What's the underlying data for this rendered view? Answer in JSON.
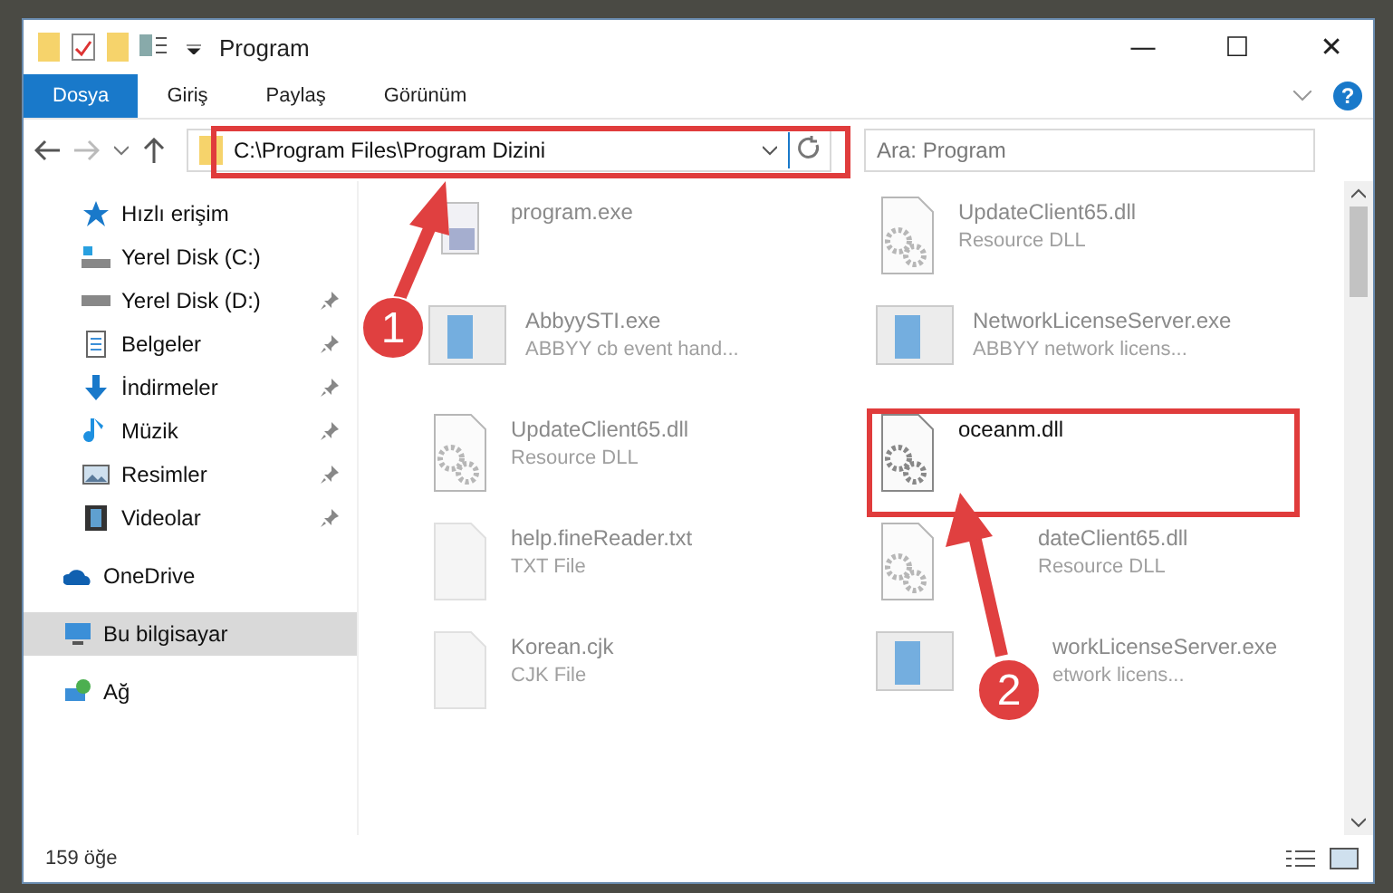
{
  "window": {
    "title": "Program",
    "minimize": "—",
    "maximize": "☐",
    "close": "✕",
    "help": "?"
  },
  "ribbon_tabs": [
    {
      "label": "Dosya",
      "selected": true
    },
    {
      "label": "Giriş",
      "selected": false
    },
    {
      "label": "Paylaş",
      "selected": false
    },
    {
      "label": "Görünüm",
      "selected": false
    }
  ],
  "address_bar": {
    "path": "C:\\Program Files\\Program Dizini"
  },
  "search": {
    "placeholder": "Ara: Program"
  },
  "sidebar": {
    "items": [
      {
        "label": "Hızlı erişim",
        "kind": "star",
        "pinned": false,
        "selected": false
      },
      {
        "label": "Yerel Disk (C:)",
        "kind": "drive-c",
        "pinned": false,
        "selected": false
      },
      {
        "label": "Yerel Disk (D:)",
        "kind": "drive",
        "pinned": true,
        "selected": false
      },
      {
        "label": "Belgeler",
        "kind": "doc",
        "pinned": true,
        "selected": false
      },
      {
        "label": "İndirmeler",
        "kind": "download",
        "pinned": true,
        "selected": false
      },
      {
        "label": "Müzik",
        "kind": "music",
        "pinned": true,
        "selected": false
      },
      {
        "label": "Resimler",
        "kind": "pictures",
        "pinned": true,
        "selected": false
      },
      {
        "label": "Videolar",
        "kind": "video",
        "pinned": true,
        "selected": false
      },
      {
        "label": "OneDrive",
        "kind": "cloud",
        "pinned": false,
        "selected": false
      },
      {
        "label": "Bu bilgisayar",
        "kind": "pc",
        "pinned": false,
        "selected": true
      },
      {
        "label": "Ağ",
        "kind": "network",
        "pinned": false,
        "selected": false
      }
    ]
  },
  "files": [
    {
      "name": "program.exe",
      "kind": "app",
      "blurred": true
    },
    {
      "name": "UpdateClient65.dll",
      "description": "Resource DLL",
      "kind": "dll",
      "blurred": true
    },
    {
      "name": "AbbyySTI.exe",
      "description": "ABBYY cb event hand...",
      "kind": "window",
      "blurred": true
    },
    {
      "name": "NetworkLicenseServer.exe",
      "description": "ABBYY network licens...",
      "kind": "window",
      "blurred": true
    },
    {
      "name": "UpdateClient65.dll",
      "description": "Resource DLL",
      "kind": "dll",
      "blurred": true
    },
    {
      "name": "oceanm.dll",
      "kind": "dll",
      "blurred": false
    },
    {
      "name": "help.fineReader.txt",
      "description": "TXT File",
      "kind": "blank",
      "blurred": true
    },
    {
      "name": "dateClient65.dll",
      "description": "Resource DLL",
      "kind": "dll",
      "blurred": true,
      "covered": true
    },
    {
      "name": "Korean.cjk",
      "description": "CJK File",
      "kind": "blank",
      "blurred": true
    },
    {
      "name": "workLicenseServer.exe",
      "description": "etwork licens...",
      "kind": "window",
      "blurred": true,
      "covered": true
    }
  ],
  "annotations": [
    {
      "label": "1"
    },
    {
      "label": "2"
    }
  ],
  "status_bar": {
    "count": "159 öğe"
  }
}
